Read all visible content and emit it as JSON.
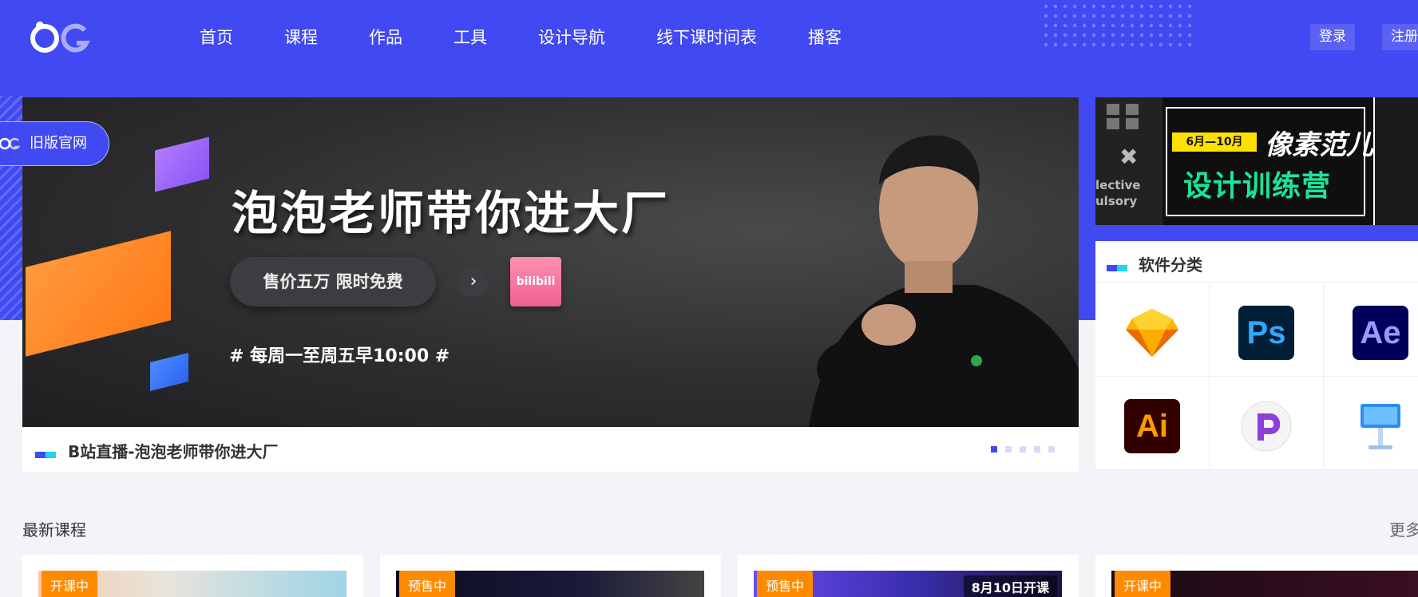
{
  "header": {
    "nav": [
      "首页",
      "课程",
      "作品",
      "工具",
      "设计导航",
      "线下课时间表",
      "播客"
    ],
    "login_label": "登录",
    "register_label": "注册"
  },
  "old_site_label": "旧版官网",
  "banner": {
    "title": "泡泡老师带你进大厂",
    "price_text": "售价五万 限时免费",
    "arrow": "›",
    "bili_label": "bilibili",
    "schedule": "# 每周一至周五早10:00 #",
    "caption": "B站直播-泡泡老师带你进大厂",
    "slide_count": 5,
    "active_slide": 0
  },
  "ad": {
    "date_label": "6月—10月",
    "brand": "像素范儿",
    "campaign": "设计训练营",
    "side_words": [
      "lective",
      "ulsory"
    ]
  },
  "software": {
    "title": "软件分类",
    "icons": [
      "sketch-icon",
      "photoshop-icon",
      "after-effects-icon",
      "illustrator-icon",
      "principle-icon",
      "keynote-icon"
    ],
    "labels": [
      "",
      "Ps",
      "Ae",
      "Ai",
      "",
      ""
    ]
  },
  "courses": {
    "title": "最新课程",
    "more": "更多",
    "cards": [
      {
        "badge": "开课中",
        "date": ""
      },
      {
        "badge": "预售中",
        "date": ""
      },
      {
        "badge": "预售中",
        "date": "8月10日开课"
      },
      {
        "badge": "开课中",
        "date": ""
      }
    ]
  },
  "colors": {
    "brand_blue": "#4149f2",
    "accent_cyan": "#1fd6f2",
    "badge_orange": "#ff8a00",
    "ad_green": "#19e59a",
    "ad_yellow": "#ffe100"
  }
}
